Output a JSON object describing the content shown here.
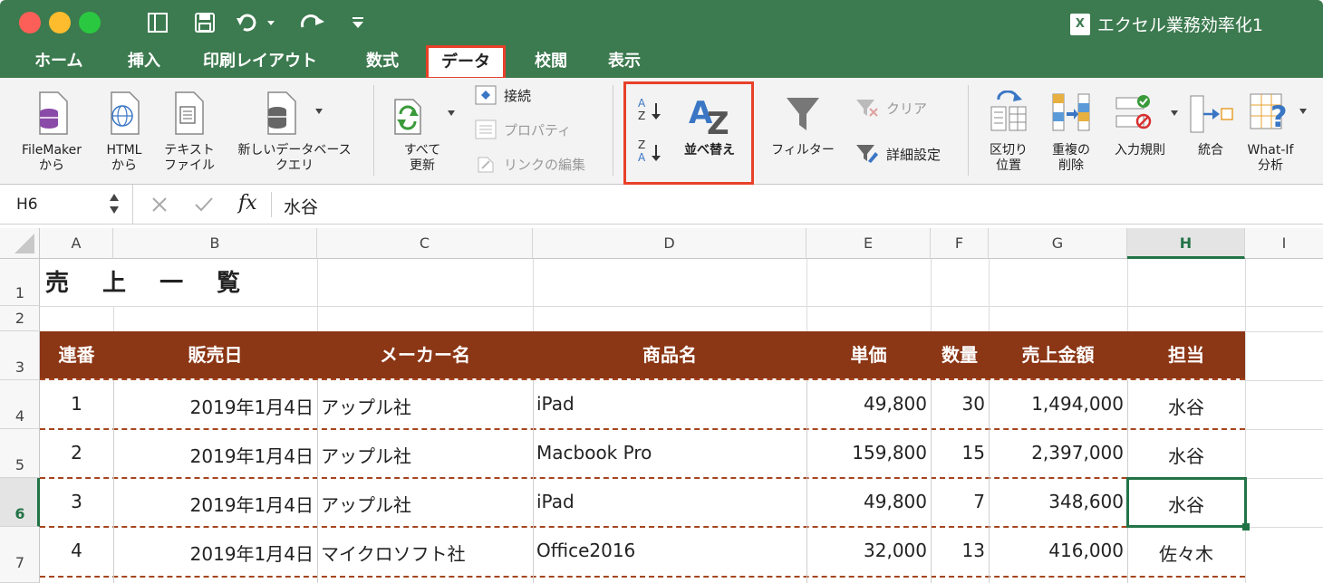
{
  "app": {
    "doc_title": "エクセル業務効率化1",
    "colors": {
      "title_bar": "#3c7a4f",
      "accent": "#e8402a",
      "header_fill": "#8b3615",
      "selection": "#217346"
    }
  },
  "quick_access": {
    "sidebar_icon": "sidebar-icon",
    "save_icon": "save-icon",
    "undo_icon": "undo-icon",
    "redo_icon": "redo-icon",
    "customize_icon": "customize-icon"
  },
  "tabs": [
    "ホーム",
    "挿入",
    "印刷レイアウト",
    "数式",
    "データ",
    "校閲",
    "表示"
  ],
  "ribbon": {
    "filemaker": "FileMaker\nから",
    "html": "HTML\nから",
    "text_file": "テキスト\nファイル",
    "new_db_query": "新しいデータベース\nクエリ",
    "refresh_all": "すべて\n更新",
    "connections": "接続",
    "properties": "プロパティ",
    "edit_links": "リンクの編集",
    "sort": "並べ替え",
    "filter": "フィルター",
    "clear": "クリア",
    "advanced": "詳細設定",
    "text_to_columns": "区切り\n位置",
    "remove_duplicates": "重複の\n削除",
    "data_validation": "入力規則",
    "consolidate": "統合",
    "what_if": "What-If\n分析"
  },
  "formula_bar": {
    "name_box": "H6",
    "fx_label": "fx",
    "value": "水谷"
  },
  "sheet": {
    "columns": [
      "A",
      "B",
      "C",
      "D",
      "E",
      "F",
      "G",
      "H",
      "I"
    ],
    "rows": [
      "1",
      "2",
      "3",
      "4",
      "5",
      "6",
      "7"
    ],
    "title": "売 上 一 覧",
    "headers": [
      "連番",
      "販売日",
      "メーカー名",
      "商品名",
      "単価",
      "数量",
      "売上金額",
      "担当"
    ],
    "records": [
      [
        "1",
        "2019年1月4日",
        "アップル社",
        "iPad",
        "49,800",
        "30",
        "1,494,000",
        "水谷"
      ],
      [
        "2",
        "2019年1月4日",
        "アップル社",
        "Macbook Pro",
        "159,800",
        "15",
        "2,397,000",
        "水谷"
      ],
      [
        "3",
        "2019年1月4日",
        "アップル社",
        "iPad",
        "49,800",
        "7",
        "348,600",
        "水谷"
      ],
      [
        "4",
        "2019年1月4日",
        "マイクロソフト社",
        "Office2016",
        "32,000",
        "13",
        "416,000",
        "佐々木"
      ]
    ]
  }
}
